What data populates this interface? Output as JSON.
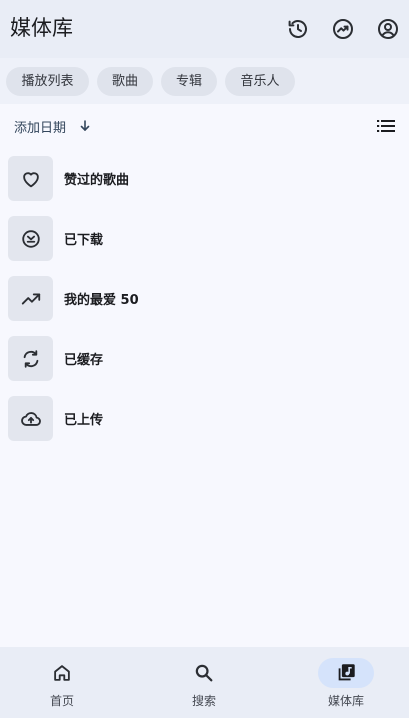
{
  "header": {
    "title": "媒体库",
    "icons": [
      "history-icon",
      "trending-icon",
      "account-icon"
    ]
  },
  "chips": [
    "播放列表",
    "歌曲",
    "专辑",
    "音乐人"
  ],
  "sort": {
    "label": "添加日期",
    "direction_icon": "arrow-down-icon",
    "view_icon": "list-view-icon"
  },
  "items": [
    {
      "label": "赞过的歌曲",
      "icon": "heart-outline-icon"
    },
    {
      "label": "已下载",
      "icon": "download-done-icon"
    },
    {
      "label": "我的最爱 50",
      "icon": "trending-up-icon"
    },
    {
      "label": "已缓存",
      "icon": "sync-icon"
    },
    {
      "label": "已上传",
      "icon": "cloud-upload-icon"
    }
  ],
  "nav": [
    {
      "label": "首页",
      "icon": "home-icon",
      "active": false
    },
    {
      "label": "搜索",
      "icon": "search-icon",
      "active": false
    },
    {
      "label": "媒体库",
      "icon": "library-music-icon",
      "active": true
    }
  ],
  "colors": {
    "active_pill": "#d5e3fb",
    "background": "#f7f8fe",
    "bar": "#e9edf6"
  }
}
